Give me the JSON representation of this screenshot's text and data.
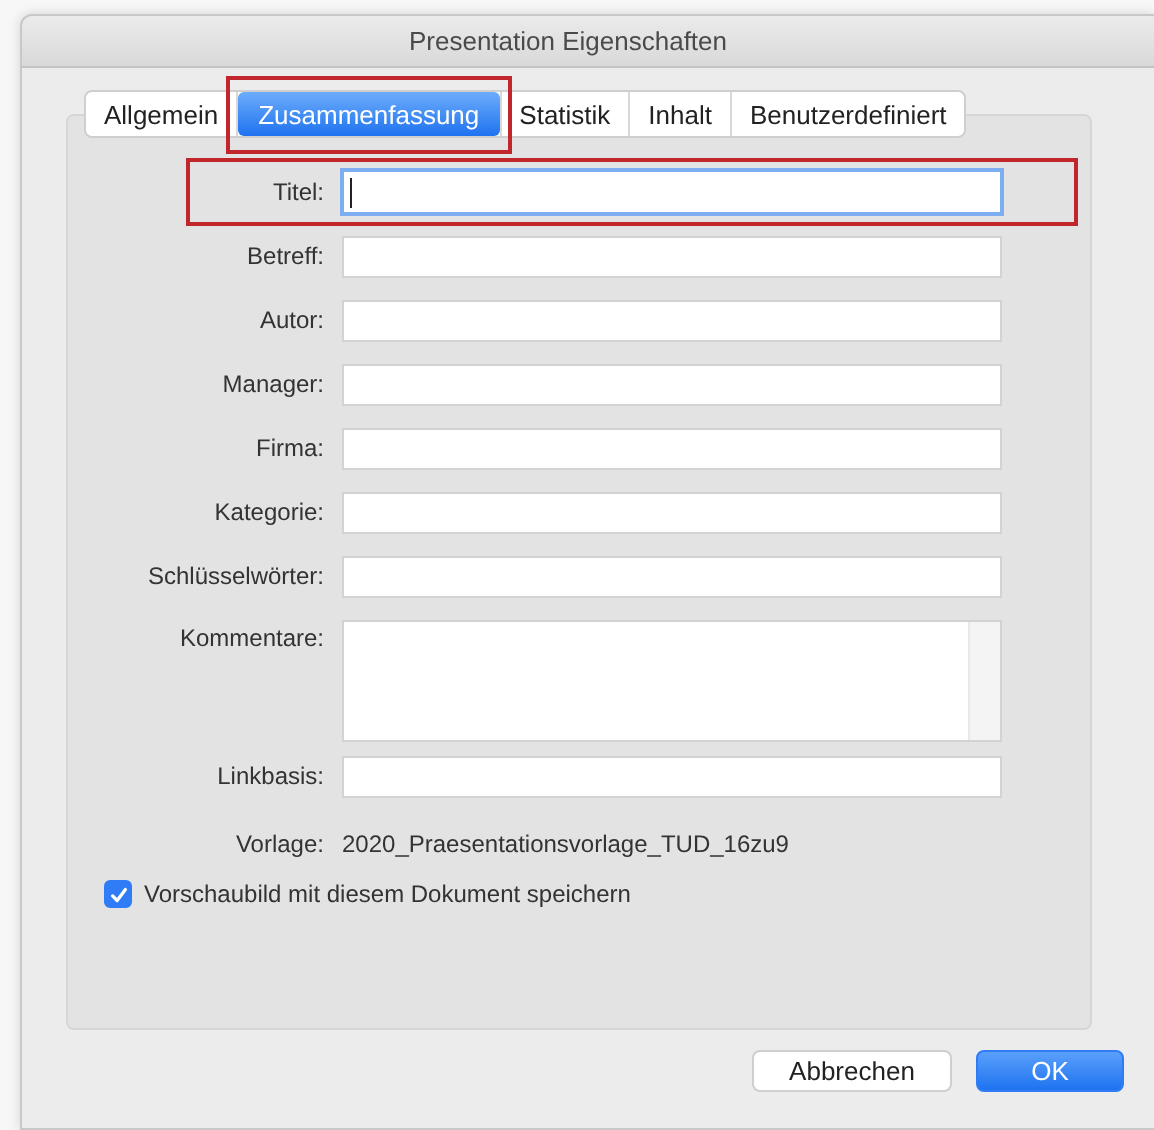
{
  "window": {
    "title": "Presentation Eigenschaften"
  },
  "tabs": [
    {
      "label": "Allgemein",
      "selected": false,
      "highlighted": false
    },
    {
      "label": "Zusammenfassung",
      "selected": true,
      "highlighted": true
    },
    {
      "label": "Statistik",
      "selected": false,
      "highlighted": false
    },
    {
      "label": "Inhalt",
      "selected": false,
      "highlighted": false
    },
    {
      "label": "Benutzerdefiniert",
      "selected": false,
      "highlighted": false
    }
  ],
  "fields": [
    {
      "kind": "text",
      "label": "Titel:",
      "focused": true,
      "highlighted": true
    },
    {
      "kind": "text",
      "label": "Betreff:",
      "focused": false,
      "highlighted": false
    },
    {
      "kind": "text",
      "label": "Autor:",
      "focused": false,
      "highlighted": false
    },
    {
      "kind": "text",
      "label": "Manager:",
      "focused": false,
      "highlighted": false
    },
    {
      "kind": "text",
      "label": "Firma:",
      "focused": false,
      "highlighted": false
    },
    {
      "kind": "text",
      "label": "Kategorie:",
      "focused": false,
      "highlighted": false
    },
    {
      "kind": "text",
      "label": "Schlüsselwörter:",
      "focused": false,
      "highlighted": false
    },
    {
      "kind": "textarea",
      "label": "Kommentare:",
      "focused": false,
      "highlighted": false
    },
    {
      "kind": "text",
      "label": "Linkbasis:",
      "focused": false,
      "highlighted": false
    },
    {
      "kind": "static",
      "label": "Vorlage:",
      "value": "2020_Praesentationsvorlage_TUD_16zu9"
    }
  ],
  "checkbox": {
    "label": "Vorschaubild mit diesem Dokument speichern",
    "checked": true
  },
  "buttons": [
    {
      "label": "Abbrechen",
      "default": false
    },
    {
      "label": "OK",
      "default": true
    }
  ]
}
